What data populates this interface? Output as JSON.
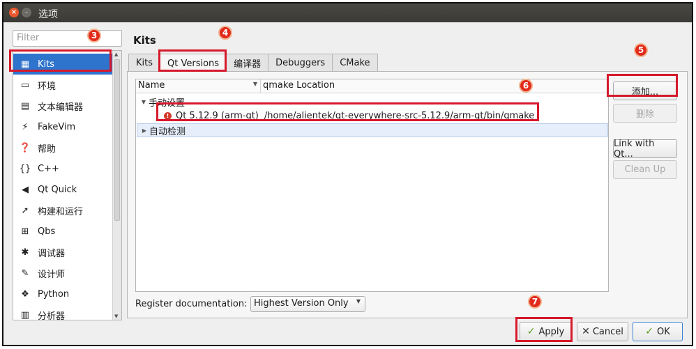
{
  "window": {
    "title": "选项",
    "close_glyph": "×",
    "min_glyph": "–"
  },
  "filter": {
    "placeholder": "Filter"
  },
  "sidebar": {
    "items": [
      {
        "label": "Kits",
        "icon": "kits-icon",
        "glyph": "▦",
        "selected": true
      },
      {
        "label": "环境",
        "icon": "monitor-icon",
        "glyph": "▭"
      },
      {
        "label": "文本编辑器",
        "icon": "text-editor-icon",
        "glyph": "▤"
      },
      {
        "label": "FakeVim",
        "icon": "fakevim-icon",
        "glyph": "⚡"
      },
      {
        "label": "帮助",
        "icon": "help-icon",
        "glyph": "❓"
      },
      {
        "label": "C++",
        "icon": "braces-icon",
        "glyph": "{}"
      },
      {
        "label": "Qt Quick",
        "icon": "qt-quick-icon",
        "glyph": "◀"
      },
      {
        "label": "构建和运行",
        "icon": "build-run-icon",
        "glyph": "➚"
      },
      {
        "label": "Qbs",
        "icon": "qbs-icon",
        "glyph": "⊞"
      },
      {
        "label": "调试器",
        "icon": "debugger-icon",
        "glyph": "✱"
      },
      {
        "label": "设计师",
        "icon": "designer-icon",
        "glyph": "✎"
      },
      {
        "label": "Python",
        "icon": "python-icon",
        "glyph": "❖"
      },
      {
        "label": "分析器",
        "icon": "analyzer-icon",
        "glyph": "▥"
      }
    ]
  },
  "main": {
    "heading": "Kits",
    "tabs": [
      {
        "label": "Kits"
      },
      {
        "label": "Qt Versions",
        "active": true
      },
      {
        "label": "编译器"
      },
      {
        "label": "Debuggers"
      },
      {
        "label": "CMake"
      }
    ],
    "tree": {
      "col_name": "Name",
      "col_location": "qmake Location",
      "groups": [
        {
          "label": "手动设置",
          "expanded": true,
          "items": [
            {
              "name": "Qt 5.12.9 (arm-qt)",
              "location": "/home/alientek/qt-everywhere-src-5.12.9/arm-qt/bin/qmake",
              "status": "error"
            }
          ]
        },
        {
          "label": "自动检测",
          "expanded": false
        }
      ]
    },
    "buttons": {
      "add": "添加...",
      "remove": "删除",
      "link_qt": "Link with Qt...",
      "clean_up": "Clean Up"
    },
    "register_doc": {
      "label": "Register documentation:",
      "value": "Highest Version Only"
    }
  },
  "footer": {
    "apply": "Apply",
    "cancel": "Cancel",
    "ok": "OK"
  },
  "annotations": {
    "markers": [
      "3",
      "4",
      "5",
      "6",
      "7"
    ],
    "color": "#d6192b"
  }
}
